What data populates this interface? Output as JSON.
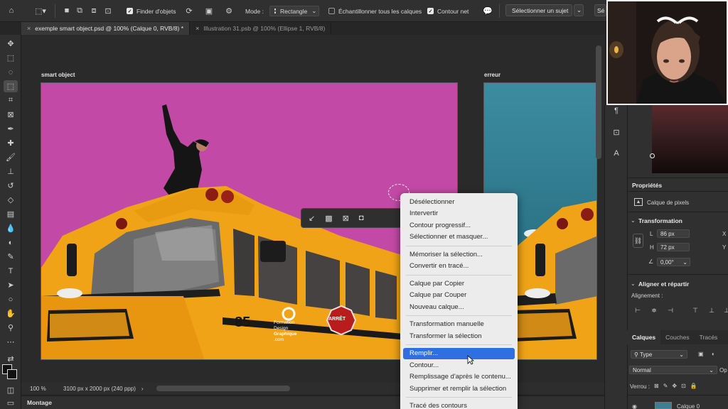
{
  "options_bar": {
    "sample_all_label": "Finder d'objets",
    "mode_label": "Mode :",
    "mode_value": "Rectangle",
    "sample_all_layers_label": "Échantillonner tous les calques",
    "hard_edge_label": "Contour net",
    "select_subject_label": "Sélectionner un sujet",
    "select_mask_short": "Sé"
  },
  "tabs": [
    {
      "label": "exemple smart object.psd @ 100% (Calque 0, RVB/8) *",
      "active": true
    },
    {
      "label": "Illustration 31.psb @ 100% (Ellipse 1, RVB/8)",
      "active": false
    }
  ],
  "canvas": {
    "artboard1_label": "smart object",
    "artboard2_label": "erreur",
    "bus_number": "85",
    "stop_sign_text": "ARRÊT",
    "bus_logo_lines": [
      "Formation",
      "Design",
      "Graphique",
      ".com"
    ]
  },
  "status": {
    "zoom": "100 %",
    "doc_size": "3100 px x 2000 px (240 ppp)",
    "bottom_tab": "Montage"
  },
  "properties": {
    "title": "Propriétés",
    "layer_type": "Calque de pixels",
    "transform_title": "Transformation",
    "w_label": "L",
    "w_value": "86 px",
    "h_label": "H",
    "h_value": "72 px",
    "x_short": "X",
    "y_short": "Y",
    "angle_value": "0,00°",
    "align_title": "Aligner et répartir",
    "align_label": "Alignement :"
  },
  "layers": {
    "tabs": [
      "Calques",
      "Couches",
      "Tracés"
    ],
    "filter_value": "Type",
    "blend_mode": "Normal",
    "opacity_short": "Op",
    "lock_label": "Verrou :",
    "layer_name": "Calque 0"
  },
  "context_menu": {
    "groups": [
      [
        "Désélectionner",
        "Intervertir",
        "Contour progressif...",
        "Sélectionner et masquer..."
      ],
      [
        "Mémoriser la sélection...",
        "Convertir en tracé..."
      ],
      [
        "Calque par Copier",
        "Calque par Couper",
        "Nouveau calque..."
      ],
      [
        "Transformation manuelle",
        "Transformer la sélection"
      ],
      [
        "Remplir...",
        "Contour...",
        "Remplissage d'après le contenu...",
        "Supprimer et remplir la sélection"
      ],
      [
        "Tracé des contours"
      ]
    ],
    "highlighted": "Remplir..."
  },
  "colors": {
    "canvas_bg": "#c24aa6",
    "bus_yellow": "#f2a516",
    "menu_highlight": "#2f6fe0"
  }
}
